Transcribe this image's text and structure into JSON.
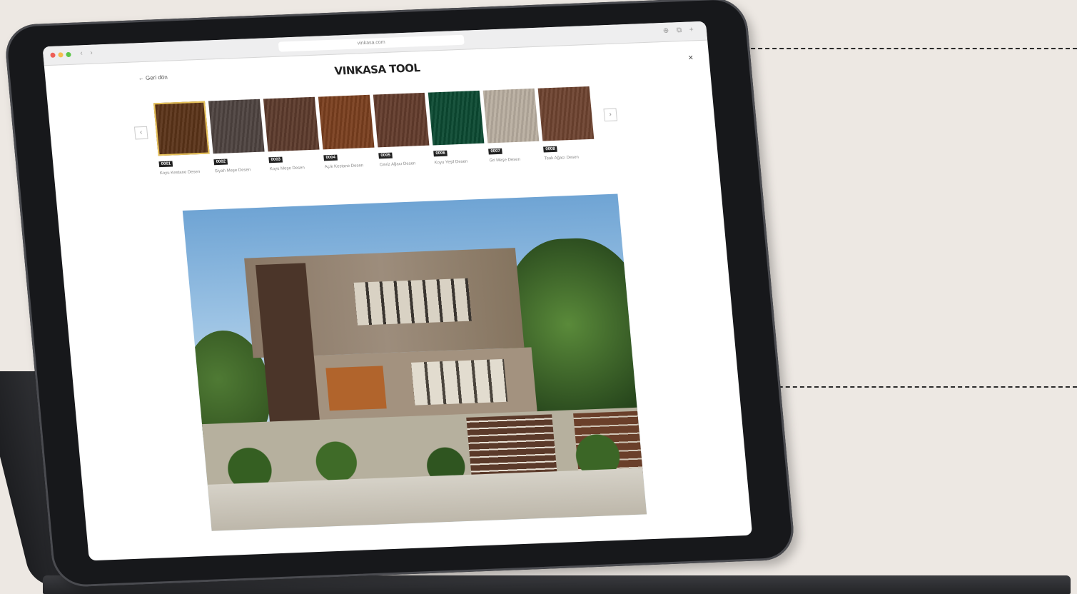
{
  "browser": {
    "url": "vinkasa.com",
    "nav_back": "‹",
    "nav_forward": "›",
    "tab_icons": "⊕ ⧉ +"
  },
  "page": {
    "back_label": "← Geri dön",
    "logo": "VINKASA TOOL",
    "close": "×",
    "arrow_prev": "‹",
    "arrow_next": "›"
  },
  "swatches": [
    {
      "code": "0001",
      "name": "Koyu Kestane Desen",
      "color": "#5a3318",
      "selected": true
    },
    {
      "code": "0002",
      "name": "Siyah Meşe Desen",
      "color": "#4e4340",
      "selected": false
    },
    {
      "code": "0003",
      "name": "Koyu Meşe Desen",
      "color": "#5c3a2c",
      "selected": false
    },
    {
      "code": "0004",
      "name": "Açık Kestane Desen",
      "color": "#7a3f1e",
      "selected": false
    },
    {
      "code": "0005",
      "name": "Ceviz Ağacı Desen",
      "color": "#633c2c",
      "selected": false
    },
    {
      "code": "0006",
      "name": "Koyu Yeşil Desen",
      "color": "#0c4a32",
      "selected": false
    },
    {
      "code": "0007",
      "name": "Gri Meşe Desen",
      "color": "#b9aea0",
      "selected": false
    },
    {
      "code": "0008",
      "name": "Teak Ağacı Desen",
      "color": "#6e4330",
      "selected": false
    }
  ]
}
